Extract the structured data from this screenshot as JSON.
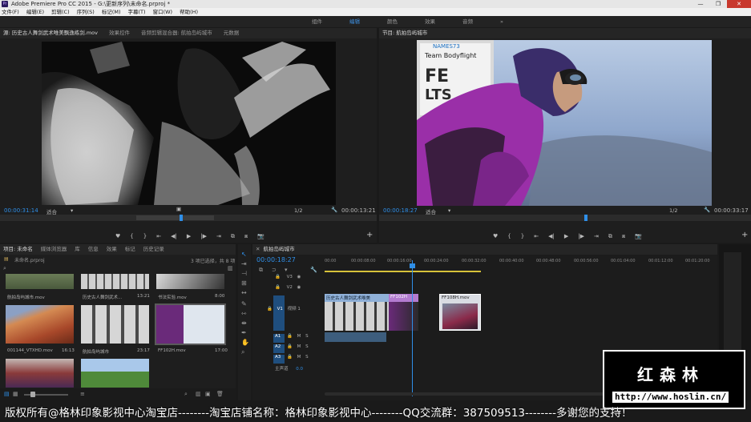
{
  "window": {
    "title": "Adobe Premiere Pro CC 2015 - G:\\更新序列\\未命名.prproj *",
    "app_icon": "Pr",
    "controls": [
      "—",
      "❐",
      "✕"
    ]
  },
  "menu": [
    "文件(F)",
    "编辑(E)",
    "剪辑(C)",
    "序列(S)",
    "标记(M)",
    "字幕(T)",
    "窗口(W)",
    "帮助(H)"
  ],
  "workspaces": {
    "items": [
      "组件",
      "编辑",
      "颜色",
      "效果",
      "音频",
      "»"
    ],
    "active_index": 1
  },
  "source_monitor": {
    "tabs": [
      "源: 历史古人舞剑武术唯美飘逸练剑.mov",
      "效果控件",
      "音频剪辑混合器: 航拍岛屿城市",
      "元数据"
    ],
    "timecode_left": "00:00:31:14",
    "fit": "适合",
    "quality": "1/2",
    "timecode_right": "00:00:13:21",
    "controls": [
      "♥",
      "{",
      "}",
      "⇤",
      "◀|",
      "▶",
      "|▶",
      "⇥",
      "⧉",
      "⧈",
      "📷"
    ]
  },
  "program_monitor": {
    "tabs": [
      "节目: 航拍岛屿城市"
    ],
    "timecode_left": "00:00:18:27",
    "fit": "适合",
    "quality": "1/2",
    "timecode_right": "00:00:33:17",
    "controls": [
      "♥",
      "{",
      "}",
      "⇤",
      "◀|",
      "▶",
      "|▶",
      "⇥",
      "⧉",
      "⧈",
      "📷"
    ],
    "overlay_text": [
      "NAMES73",
      "Team Bodyflight",
      "FE",
      "LTS"
    ]
  },
  "project_panel": {
    "tabs": [
      "项目: 未命名",
      "媒体浏览器",
      "库",
      "信息",
      "效果",
      "标记",
      "历史记录"
    ],
    "file": "未命名.prproj",
    "selection": "3 项已选择，共 8 项",
    "items": [
      {
        "name": "航拍岛屿城市.mov",
        "duration": ""
      },
      {
        "name": "历史古人舞剑武术...",
        "duration": "13:21"
      },
      {
        "name": "书法实验.mov",
        "duration": "8:00"
      },
      {
        "name": "001144_VTXHD.mov",
        "duration": "16:13"
      },
      {
        "name": "航拍岛屿城市",
        "duration": "23:17"
      },
      {
        "name": "FF102H.mov",
        "duration": "17:00"
      }
    ]
  },
  "timeline": {
    "tab": "航拍岛屿城市",
    "timecode": "00:00:18:27",
    "ruler": [
      "00:00",
      "00:00:08:00",
      "00:00:16:00",
      "00:00:24:00",
      "00:00:32:00",
      "00:00:40:00",
      "00:00:48:00",
      "00:00:56:00",
      "00:01:04:00",
      "00:01:12:00",
      "00:01:20:00"
    ],
    "tracks": [
      {
        "id": "V3",
        "label": ""
      },
      {
        "id": "V2",
        "label": ""
      },
      {
        "id": "V1",
        "label": "视频 1"
      },
      {
        "id": "A1",
        "label": ""
      },
      {
        "id": "A2",
        "label": ""
      },
      {
        "id": "A3",
        "label": ""
      },
      {
        "id": "",
        "label": "主声道",
        "value": "0.0"
      }
    ],
    "clips": [
      "历史古人舞剑武术唯美",
      "FF102H",
      "FF108H.mov"
    ]
  },
  "watermark": {
    "title": "红森林",
    "url": "http://www.hoslin.cn/"
  },
  "banner": "版权所有@格林印象影视中心淘宝店--------淘宝店铺名称：格林印象影视中心--------QQ交流群：387509513--------多谢您的支持！",
  "colors": {
    "accent": "#2f8fe8",
    "v1_track": "#1f4e7e",
    "clip": "#8fb0d8"
  }
}
